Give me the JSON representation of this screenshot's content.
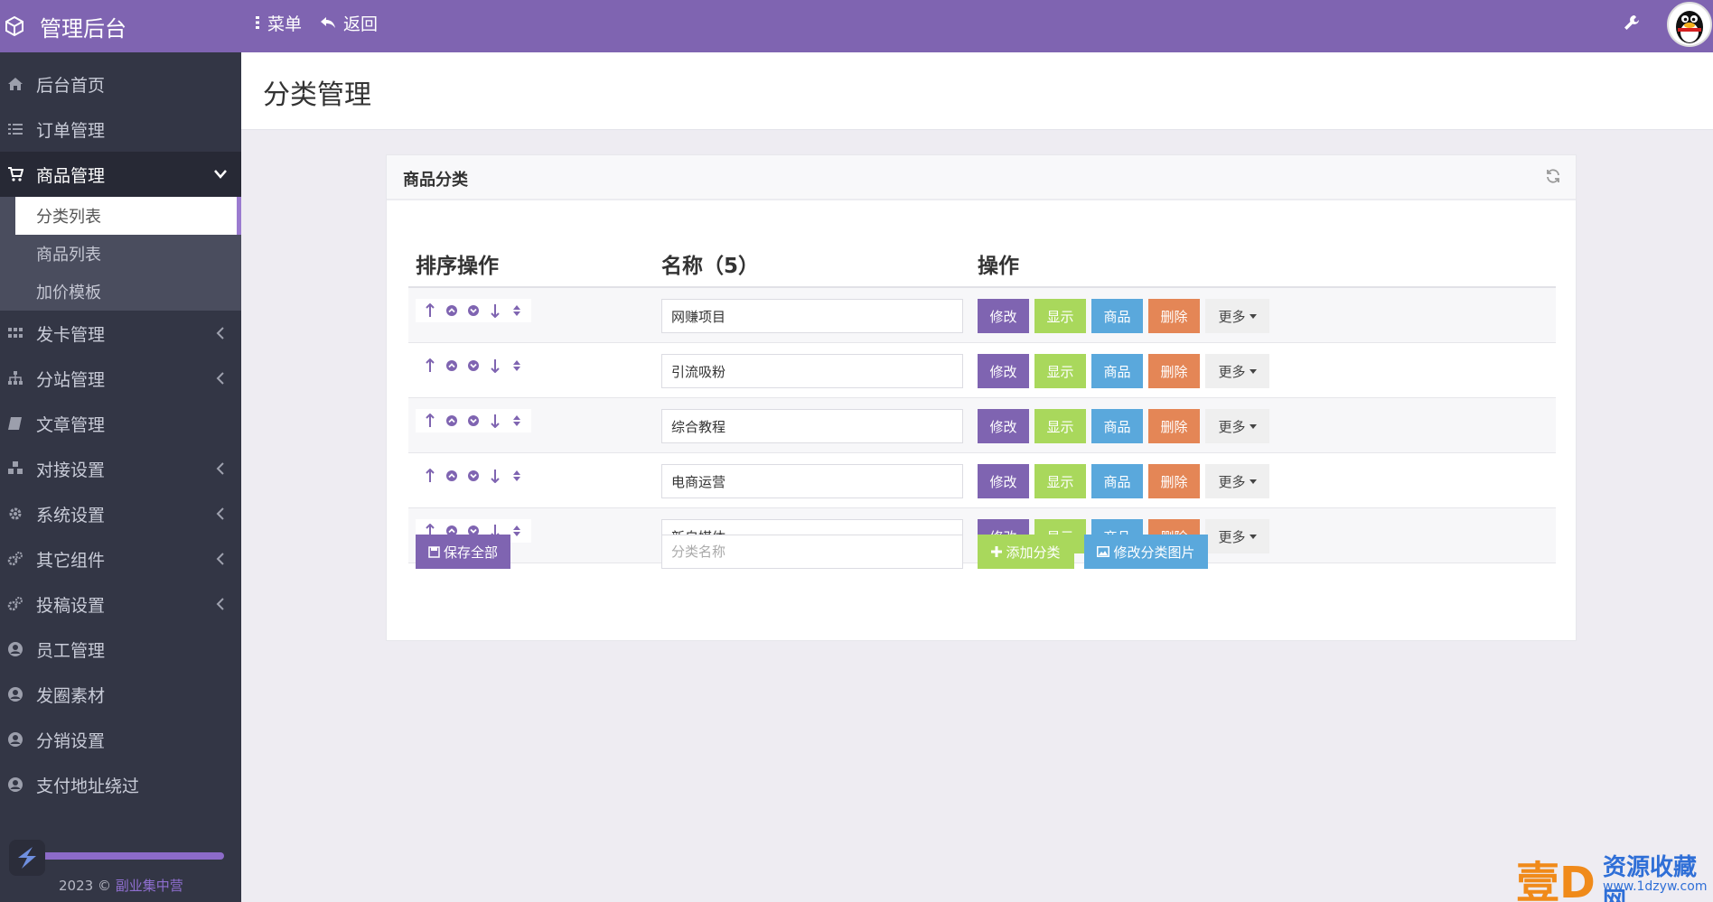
{
  "app": {
    "title": "管理后台",
    "menu_label": "菜单",
    "back_label": "返回"
  },
  "sidebar": {
    "items": [
      {
        "label": "后台首页",
        "icon": "home-icon"
      },
      {
        "label": "订单管理",
        "icon": "list-icon"
      },
      {
        "label": "商品管理",
        "icon": "cart-icon",
        "expanded": true,
        "children": [
          {
            "label": "分类列表",
            "current": true
          },
          {
            "label": "商品列表"
          },
          {
            "label": "加价模板"
          }
        ]
      },
      {
        "label": "发卡管理",
        "icon": "grid-icon"
      },
      {
        "label": "分站管理",
        "icon": "sitemap-icon"
      },
      {
        "label": "文章管理",
        "icon": "book-icon"
      },
      {
        "label": "对接设置",
        "icon": "cubes-icon"
      },
      {
        "label": "系统设置",
        "icon": "gear-icon"
      },
      {
        "label": "其它组件",
        "icon": "gears-icon"
      },
      {
        "label": "投稿设置",
        "icon": "gears-icon"
      },
      {
        "label": "员工管理",
        "icon": "user-circle-icon"
      },
      {
        "label": "发圈素材",
        "icon": "user-circle-icon"
      },
      {
        "label": "分销设置",
        "icon": "user-circle-icon"
      },
      {
        "label": "支付地址绕过",
        "icon": "user-circle-icon"
      }
    ],
    "copyright_prefix": "2023 ©",
    "copyright_link": "副业集中营"
  },
  "page": {
    "title": "分类管理"
  },
  "panel": {
    "title": "商品分类",
    "columns": {
      "sort": "排序操作",
      "name": "名称（5）",
      "actions": "操作"
    },
    "rows": [
      {
        "name": "网赚项目"
      },
      {
        "name": "引流吸粉"
      },
      {
        "name": "综合教程"
      },
      {
        "name": "电商运营"
      },
      {
        "name": "新自媒体"
      }
    ],
    "row_actions": {
      "edit": "修改",
      "show": "显示",
      "goods": "商品",
      "delete": "删除",
      "more": "更多"
    },
    "footer": {
      "save_all": "保存全部",
      "new_placeholder": "分类名称",
      "add": "添加分类",
      "edit_images": "修改分类图片"
    }
  },
  "watermark": {
    "big": "壹D",
    "cn": "资源收藏网",
    "url": "www.1dzyw.com"
  },
  "colors": {
    "accent": "#7f64b1",
    "show": "#a9d85c",
    "goods": "#5aa8dc",
    "delete": "#e48656",
    "sidebar": "#333645"
  }
}
